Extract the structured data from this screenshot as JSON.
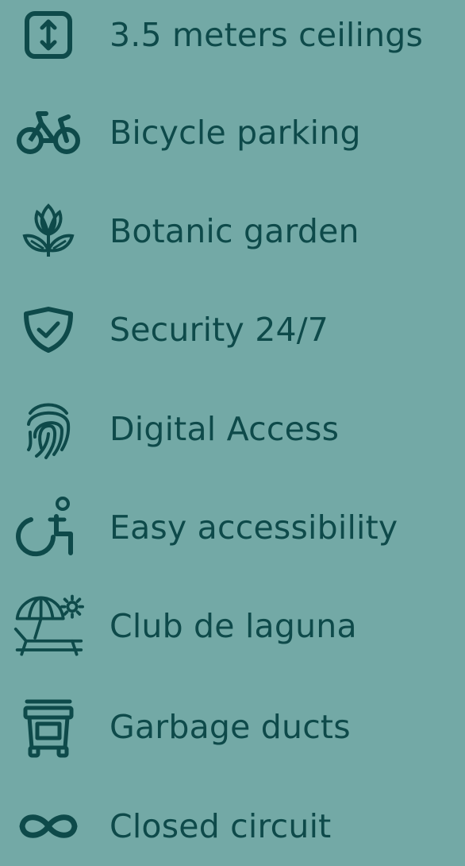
{
  "colors": {
    "background": "#73A9A6",
    "foreground": "#0E4A4A"
  },
  "features": [
    {
      "icon": "vertical-height-icon",
      "label": "3.5 meters ceilings"
    },
    {
      "icon": "bicycle-icon",
      "label": "Bicycle parking"
    },
    {
      "icon": "lotus-flower-icon",
      "label": "Botanic garden"
    },
    {
      "icon": "shield-check-icon",
      "label": "Security 24/7"
    },
    {
      "icon": "fingerprint-icon",
      "label": "Digital Access"
    },
    {
      "icon": "wheelchair-icon",
      "label": "Easy accessibility"
    },
    {
      "icon": "beach-lounger-sun-icon",
      "label": "Club de laguna"
    },
    {
      "icon": "trash-bin-icon",
      "label": "Garbage ducts"
    },
    {
      "icon": "infinity-icon",
      "label": "Closed circuit"
    }
  ]
}
